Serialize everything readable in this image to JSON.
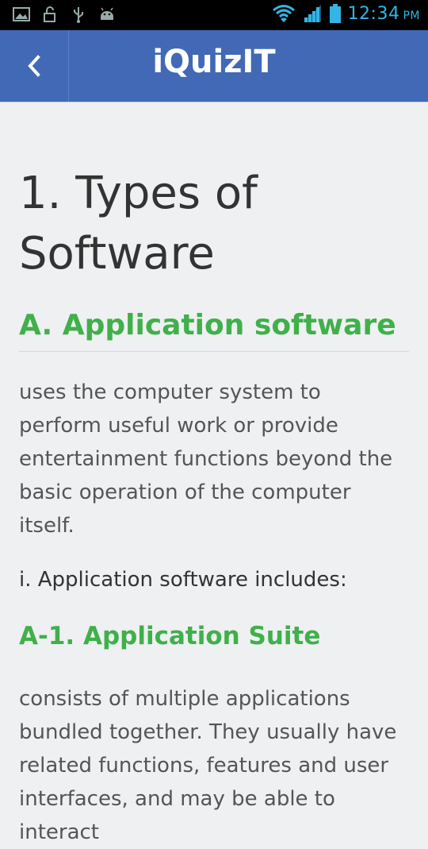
{
  "status_bar": {
    "time": "12:34",
    "ampm": "PM",
    "left_icons": [
      "image-icon",
      "lock-icon",
      "usb-icon",
      "android-icon"
    ],
    "right_icons": [
      "wifi-icon",
      "signal-icon",
      "battery-icon"
    ]
  },
  "app_bar": {
    "title": "iQuizIT",
    "back_icon": "chevron-left-icon"
  },
  "content": {
    "title": "1. Types of Software",
    "section_heading": "A. Application software",
    "description": "uses the computer system to perform useful work or provide entertainment functions beyond the basic operation of the computer itself.",
    "includes_label": "i. Application software includes:",
    "subheading": "A-1. Application Suite",
    "suite_description": "consists of multiple applications bundled together. They usually have related functions, features and user interfaces, and may be able to interact"
  },
  "colors": {
    "app_bar": "#4169b6",
    "accent_green": "#3fb04a",
    "status_blue": "#33b5e5",
    "background": "#eef0f1"
  }
}
